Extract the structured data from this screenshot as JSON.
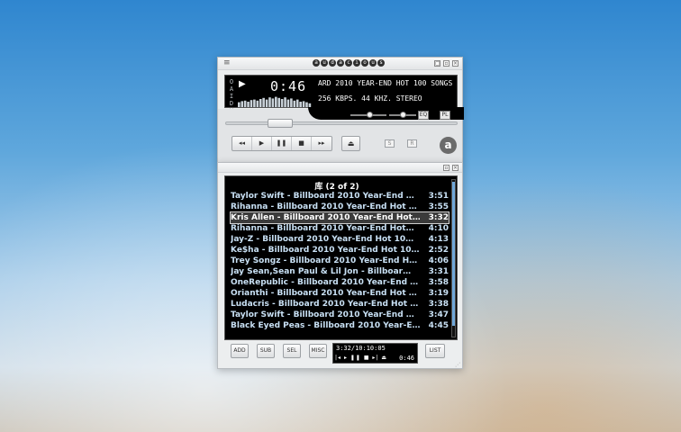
{
  "main_window": {
    "logo_letters": [
      "a",
      "u",
      "d",
      "a",
      "c",
      "i",
      "o",
      "u",
      "s"
    ],
    "menu_icon": "≡",
    "window_buttons": [
      "▢",
      "▫",
      "×"
    ],
    "vertical_label": [
      "O",
      "A",
      "I",
      "D",
      "V"
    ],
    "play_indicator": "▶",
    "time": "0:46",
    "scroll_title": "ARD 2010 YEAR-END HOT 100 SONGS",
    "stream_info": "256 KBPS.  44 KHZ.  STEREO",
    "visualizer_levels": [
      0.45,
      0.55,
      0.6,
      0.5,
      0.65,
      0.7,
      0.6,
      0.75,
      0.85,
      0.7,
      0.9,
      0.8,
      0.95,
      0.85,
      0.75,
      0.9,
      0.7,
      0.8,
      0.6,
      0.7,
      0.5,
      0.55,
      0.45,
      0.35
    ],
    "seek_progress": 0.2,
    "volume": 0.55,
    "balance": 0.5,
    "eq_button": "EQ",
    "pl_button": "PL",
    "transport": [
      "◂◂",
      "▶",
      "❚❚",
      "■",
      "▸▸"
    ],
    "eject": "⏏",
    "shuffle": "S",
    "repeat": "R",
    "about": "a"
  },
  "playlist_window": {
    "window_buttons": [
      "▫",
      "×"
    ],
    "title": "库 (2 of 2)",
    "selected_index": 2,
    "rows": [
      {
        "title": "Taylor Swift - Billboard 2010 Year-End …",
        "duration": "3:51"
      },
      {
        "title": "Rihanna - Billboard 2010 Year-End Hot …",
        "duration": "3:55"
      },
      {
        "title": "Kris Allen - Billboard 2010 Year-End Hot…",
        "duration": "3:32"
      },
      {
        "title": "Rihanna - Billboard 2010 Year-End Hot…",
        "duration": "4:10"
      },
      {
        "title": "Jay-Z - Billboard 2010 Year-End Hot 10…",
        "duration": "4:13"
      },
      {
        "title": "Ke$ha - Billboard 2010 Year-End Hot 10…",
        "duration": "2:52"
      },
      {
        "title": "Trey Songz - Billboard 2010 Year-End H…",
        "duration": "4:06"
      },
      {
        "title": "Jay Sean,Sean Paul & Lil Jon - Billboar…",
        "duration": "3:31"
      },
      {
        "title": "OneRepublic - Billboard 2010 Year-End …",
        "duration": "3:58"
      },
      {
        "title": "Orianthi - Billboard 2010 Year-End Hot …",
        "duration": "3:19"
      },
      {
        "title": "Ludacris - Billboard 2010 Year-End Hot …",
        "duration": "3:38"
      },
      {
        "title": "Taylor Swift - Billboard 2010 Year-End …",
        "duration": "3:47"
      },
      {
        "title": "Black Eyed Peas - Billboard 2010 Year-E…",
        "duration": "4:45"
      }
    ],
    "buttons": {
      "add": "ADD",
      "sub": "SUB",
      "sel": "SEL",
      "misc": "MISC",
      "list": "LIST"
    },
    "mini_time": "3:32/10:10:05",
    "mini_controls": "|◂ ▸ ❚❚ ■ ▸| ⏏",
    "mini_elapsed": "0:46",
    "resize_grip": "⋰"
  }
}
